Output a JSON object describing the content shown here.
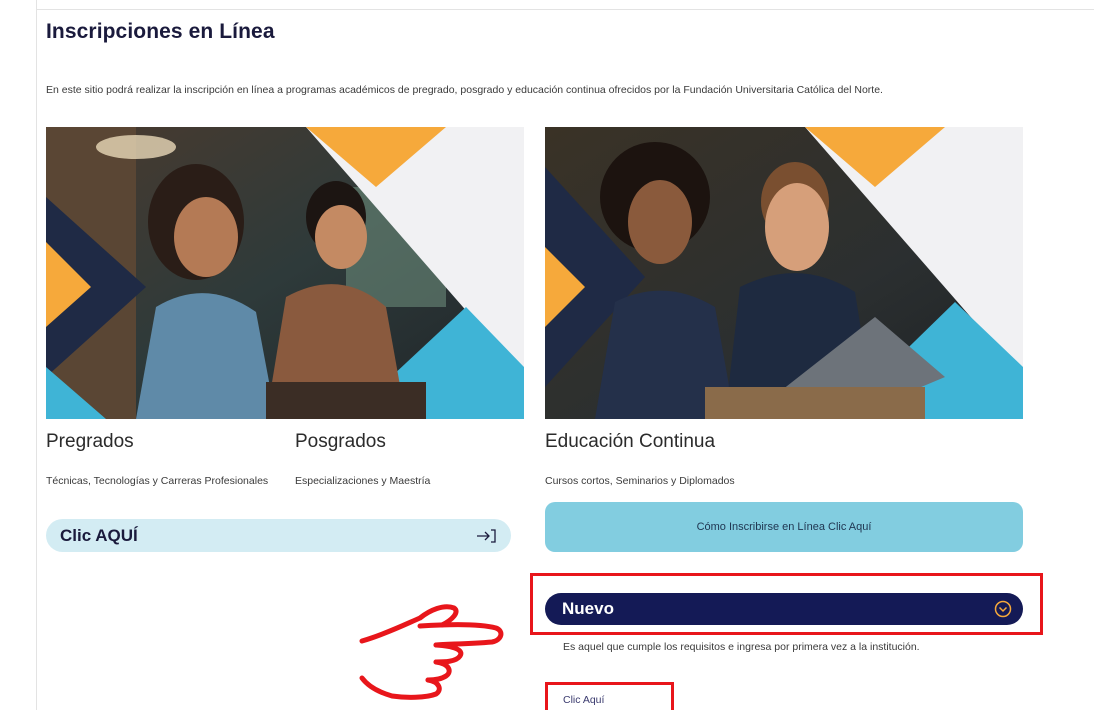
{
  "page": {
    "title": "Inscripciones en Línea",
    "intro": "En este sitio podrá realizar la inscripción en línea a programas académicos de pregrado, posgrado y educación continua ofrecidos por la Fundación Universitaria Católica del Norte."
  },
  "pregrados": {
    "title": "Pregrados",
    "subtitle": "Técnicas, Tecnologías y Carreras Profesionales"
  },
  "posgrados": {
    "title": "Posgrados",
    "subtitle": "Especializaciones y Maestría"
  },
  "clic_button": {
    "label": "Clic AQUÍ",
    "icon": "arrow-right-to-bracket-icon"
  },
  "educacion": {
    "title": "Educación Continua",
    "subtitle": "Cursos cortos, Seminarios y Diplomados",
    "button_label": "Cómo Inscribirse en Línea Clic Aquí"
  },
  "nuevo": {
    "label": "Nuevo",
    "icon": "chevron-down-circle-icon",
    "description": "Es aquel que cumple los requisitos e ingresa por primera vez a la institución.",
    "link": "Clic Aquí"
  },
  "annotations": {
    "highlight_color": "#e8161b",
    "pointer_icon": "pointing-hand-icon"
  },
  "colors": {
    "navy": "#141a56",
    "light_blue": "#d3ecf3",
    "mid_blue": "#82cde0",
    "orange": "#f6a93b",
    "teal": "#3fb4d6"
  }
}
